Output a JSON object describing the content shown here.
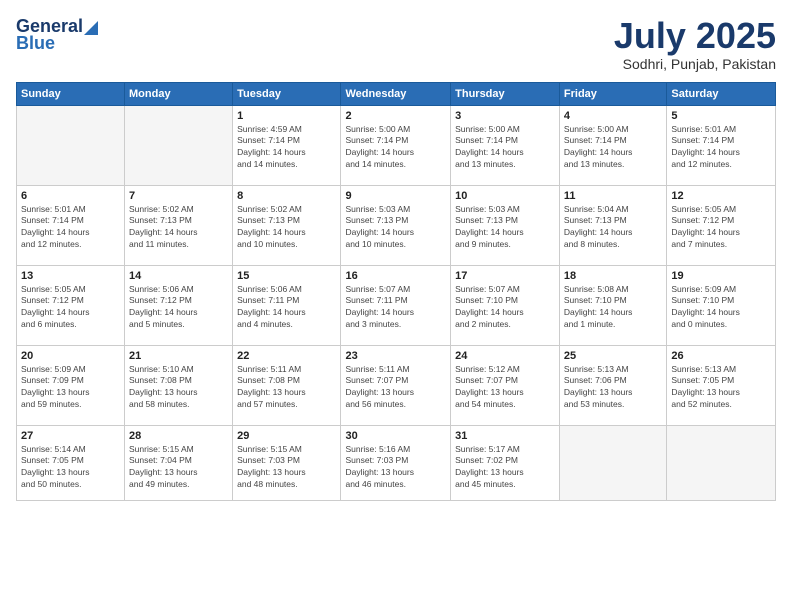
{
  "logo": {
    "line1": "General",
    "line2": "Blue"
  },
  "header": {
    "title": "July 2025",
    "subtitle": "Sodhri, Punjab, Pakistan"
  },
  "days_of_week": [
    "Sunday",
    "Monday",
    "Tuesday",
    "Wednesday",
    "Thursday",
    "Friday",
    "Saturday"
  ],
  "weeks": [
    [
      {
        "day": "",
        "info": ""
      },
      {
        "day": "",
        "info": ""
      },
      {
        "day": "1",
        "info": "Sunrise: 4:59 AM\nSunset: 7:14 PM\nDaylight: 14 hours\nand 14 minutes."
      },
      {
        "day": "2",
        "info": "Sunrise: 5:00 AM\nSunset: 7:14 PM\nDaylight: 14 hours\nand 14 minutes."
      },
      {
        "day": "3",
        "info": "Sunrise: 5:00 AM\nSunset: 7:14 PM\nDaylight: 14 hours\nand 13 minutes."
      },
      {
        "day": "4",
        "info": "Sunrise: 5:00 AM\nSunset: 7:14 PM\nDaylight: 14 hours\nand 13 minutes."
      },
      {
        "day": "5",
        "info": "Sunrise: 5:01 AM\nSunset: 7:14 PM\nDaylight: 14 hours\nand 12 minutes."
      }
    ],
    [
      {
        "day": "6",
        "info": "Sunrise: 5:01 AM\nSunset: 7:14 PM\nDaylight: 14 hours\nand 12 minutes."
      },
      {
        "day": "7",
        "info": "Sunrise: 5:02 AM\nSunset: 7:13 PM\nDaylight: 14 hours\nand 11 minutes."
      },
      {
        "day": "8",
        "info": "Sunrise: 5:02 AM\nSunset: 7:13 PM\nDaylight: 14 hours\nand 10 minutes."
      },
      {
        "day": "9",
        "info": "Sunrise: 5:03 AM\nSunset: 7:13 PM\nDaylight: 14 hours\nand 10 minutes."
      },
      {
        "day": "10",
        "info": "Sunrise: 5:03 AM\nSunset: 7:13 PM\nDaylight: 14 hours\nand 9 minutes."
      },
      {
        "day": "11",
        "info": "Sunrise: 5:04 AM\nSunset: 7:13 PM\nDaylight: 14 hours\nand 8 minutes."
      },
      {
        "day": "12",
        "info": "Sunrise: 5:05 AM\nSunset: 7:12 PM\nDaylight: 14 hours\nand 7 minutes."
      }
    ],
    [
      {
        "day": "13",
        "info": "Sunrise: 5:05 AM\nSunset: 7:12 PM\nDaylight: 14 hours\nand 6 minutes."
      },
      {
        "day": "14",
        "info": "Sunrise: 5:06 AM\nSunset: 7:12 PM\nDaylight: 14 hours\nand 5 minutes."
      },
      {
        "day": "15",
        "info": "Sunrise: 5:06 AM\nSunset: 7:11 PM\nDaylight: 14 hours\nand 4 minutes."
      },
      {
        "day": "16",
        "info": "Sunrise: 5:07 AM\nSunset: 7:11 PM\nDaylight: 14 hours\nand 3 minutes."
      },
      {
        "day": "17",
        "info": "Sunrise: 5:07 AM\nSunset: 7:10 PM\nDaylight: 14 hours\nand 2 minutes."
      },
      {
        "day": "18",
        "info": "Sunrise: 5:08 AM\nSunset: 7:10 PM\nDaylight: 14 hours\nand 1 minute."
      },
      {
        "day": "19",
        "info": "Sunrise: 5:09 AM\nSunset: 7:10 PM\nDaylight: 14 hours\nand 0 minutes."
      }
    ],
    [
      {
        "day": "20",
        "info": "Sunrise: 5:09 AM\nSunset: 7:09 PM\nDaylight: 13 hours\nand 59 minutes."
      },
      {
        "day": "21",
        "info": "Sunrise: 5:10 AM\nSunset: 7:08 PM\nDaylight: 13 hours\nand 58 minutes."
      },
      {
        "day": "22",
        "info": "Sunrise: 5:11 AM\nSunset: 7:08 PM\nDaylight: 13 hours\nand 57 minutes."
      },
      {
        "day": "23",
        "info": "Sunrise: 5:11 AM\nSunset: 7:07 PM\nDaylight: 13 hours\nand 56 minutes."
      },
      {
        "day": "24",
        "info": "Sunrise: 5:12 AM\nSunset: 7:07 PM\nDaylight: 13 hours\nand 54 minutes."
      },
      {
        "day": "25",
        "info": "Sunrise: 5:13 AM\nSunset: 7:06 PM\nDaylight: 13 hours\nand 53 minutes."
      },
      {
        "day": "26",
        "info": "Sunrise: 5:13 AM\nSunset: 7:05 PM\nDaylight: 13 hours\nand 52 minutes."
      }
    ],
    [
      {
        "day": "27",
        "info": "Sunrise: 5:14 AM\nSunset: 7:05 PM\nDaylight: 13 hours\nand 50 minutes."
      },
      {
        "day": "28",
        "info": "Sunrise: 5:15 AM\nSunset: 7:04 PM\nDaylight: 13 hours\nand 49 minutes."
      },
      {
        "day": "29",
        "info": "Sunrise: 5:15 AM\nSunset: 7:03 PM\nDaylight: 13 hours\nand 48 minutes."
      },
      {
        "day": "30",
        "info": "Sunrise: 5:16 AM\nSunset: 7:03 PM\nDaylight: 13 hours\nand 46 minutes."
      },
      {
        "day": "31",
        "info": "Sunrise: 5:17 AM\nSunset: 7:02 PM\nDaylight: 13 hours\nand 45 minutes."
      },
      {
        "day": "",
        "info": ""
      },
      {
        "day": "",
        "info": ""
      }
    ]
  ]
}
